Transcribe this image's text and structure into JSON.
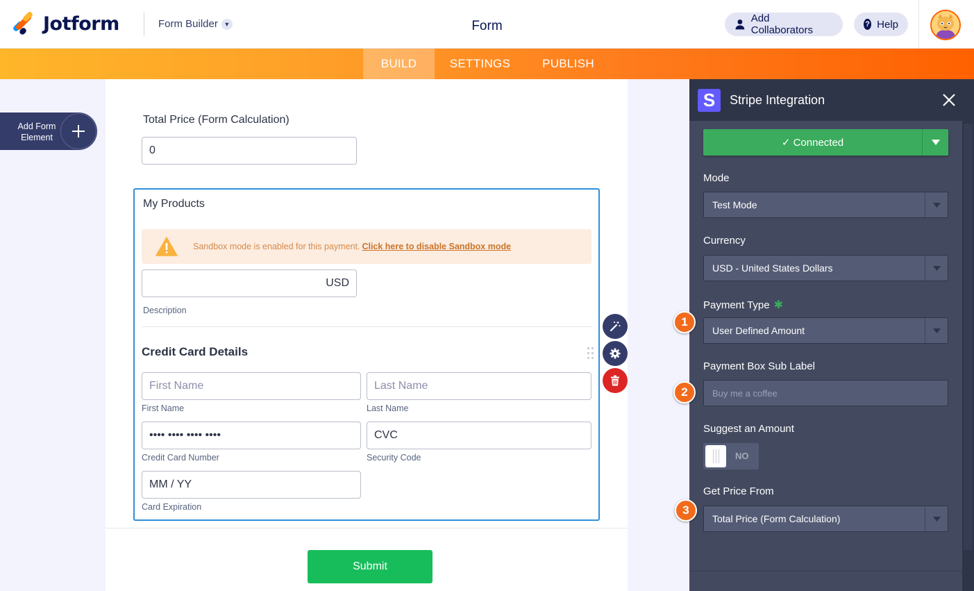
{
  "header": {
    "brand": "Jotform",
    "builder_switch": "Form Builder",
    "form_title": "Form",
    "add_collaborators": "Add Collaborators",
    "help": "Help"
  },
  "nav": {
    "tabs": [
      {
        "label": "BUILD",
        "active": true
      },
      {
        "label": "SETTINGS",
        "active": false
      },
      {
        "label": "PUBLISH",
        "active": false
      }
    ]
  },
  "left": {
    "add_element_label": "Add Form Element"
  },
  "form": {
    "total_price_label": "Total Price (Form Calculation)",
    "total_price_value": "0",
    "products_label": "My Products",
    "sandbox_text": "Sandbox mode is enabled for this payment.",
    "sandbox_link": "Click here to disable Sandbox mode",
    "currency_suffix": "USD",
    "description_sublabel": "Description",
    "credit_card_title": "Credit Card Details",
    "first_name_placeholder": "First Name",
    "first_name_sublabel": "First Name",
    "last_name_placeholder": "Last Name",
    "last_name_sublabel": "Last Name",
    "card_number_value": "•••• •••• •••• ••••",
    "card_number_sublabel": "Credit Card Number",
    "cvc_value": "CVC",
    "cvc_sublabel": "Security Code",
    "expiry_value": "MM / YY",
    "expiry_sublabel": "Card Expiration",
    "submit_label": "Submit"
  },
  "panel": {
    "title": "Stripe Integration",
    "logo_letter": "S",
    "connected_label": "✓ Connected",
    "mode_label": "Mode",
    "mode_value": "Test Mode",
    "currency_label": "Currency",
    "currency_value": "USD - United States Dollars",
    "payment_type_label": "Payment Type",
    "payment_type_value": "User Defined Amount",
    "sub_label_label": "Payment Box Sub Label",
    "sub_label_placeholder": "Buy me a coffee",
    "suggest_label": "Suggest an Amount",
    "suggest_toggle": "NO",
    "price_from_label": "Get Price From",
    "price_from_value": "Total Price (Form Calculation)"
  },
  "callouts": [
    "1",
    "2",
    "3"
  ],
  "colors": {
    "accent_orange": "#ff6100",
    "brand_navy": "#0a1551",
    "connected_green": "#3bac5d",
    "submit_green": "#18bd5b",
    "delete_red": "#dc2626",
    "selection_blue": "#2e8fdb",
    "stripe_purple": "#635bff"
  }
}
